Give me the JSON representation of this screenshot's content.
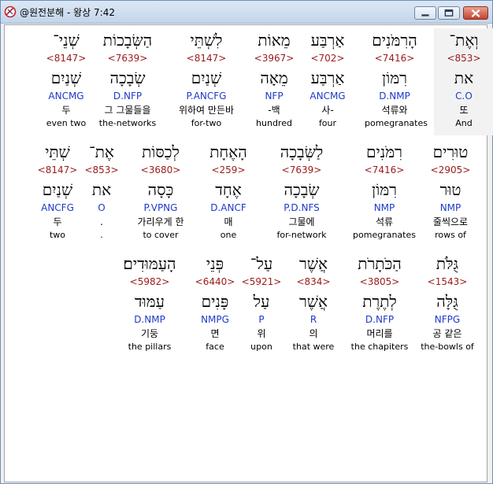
{
  "window": {
    "title": "@원전분해 - 왕상 7:42",
    "minimize_label": "minimize",
    "maximize_label": "maximize",
    "close_label": "close"
  },
  "rows": [
    {
      "words": [
        {
          "hebrew": "וְאֶת־",
          "strong": "<853>",
          "lexeme": "את",
          "morph": "C.O",
          "korean": "또",
          "english": "And",
          "highlight": true
        },
        {
          "hebrew": "הָרִמֹּנִים",
          "strong": "<7416>",
          "lexeme": "רִמּוֹן",
          "morph": "D.NMP",
          "korean": "석류와",
          "english": "pomegranates"
        },
        {
          "hebrew": "אַרְבַּע",
          "strong": "<702>",
          "lexeme": "אַרְבַּע",
          "morph": "ANCMG",
          "korean": "사-",
          "english": "four"
        },
        {
          "hebrew": "מֵאוֹת",
          "strong": "<3967>",
          "lexeme": "מֵאָה",
          "morph": "NFP",
          "korean": "-백",
          "english": "hundred"
        },
        {
          "hebrew": "לִשְׁתֵּי",
          "strong": "<8147>",
          "lexeme": "שְׁנַיִם",
          "morph": "P.ANCFG",
          "korean": "위하여 만든바",
          "english": "for-two"
        },
        {
          "hebrew": "הַשְּׂבָכוֹת",
          "strong": "<7639>",
          "lexeme": "שְׂבָכָה",
          "morph": "D.NFP",
          "korean": "그 그물들을",
          "english": "the-networks"
        },
        {
          "hebrew": "שְׁנֵי־",
          "strong": "<8147>",
          "lexeme": "שְׁנַיִם",
          "morph": "ANCMG",
          "korean": "두",
          "english": "even two"
        }
      ]
    },
    {
      "words": [
        {
          "hebrew": "טוּרִים",
          "strong": "<2905>",
          "lexeme": "טוּר",
          "morph": "NMP",
          "korean": "줄씩으로",
          "english": "rows of"
        },
        {
          "hebrew": "רִמֹּנִים",
          "strong": "<7416>",
          "lexeme": "רִמּוֹן",
          "morph": "NMP",
          "korean": "석류",
          "english": "pomegranates"
        },
        {
          "hebrew": "לַשְּׂבָכָה",
          "strong": "<7639>",
          "lexeme": "שְׂבָכָה",
          "morph": "P.D.NFS",
          "korean": "그물에",
          "english": "for-network"
        },
        {
          "hebrew": "הָאֶחָת",
          "strong": "<259>",
          "lexeme": "אֶחָד",
          "morph": "D.ANCF",
          "korean": "매",
          "english": "one"
        },
        {
          "hebrew": "לְכַסּוֹת",
          "strong": "<3680>",
          "lexeme": "כָּסָה",
          "morph": "P.VPNG",
          "korean": "가리우게 한",
          "english": "to cover"
        },
        {
          "hebrew": "אֶת־",
          "strong": "<853>",
          "lexeme": "את",
          "morph": "O",
          "korean": ".",
          "english": "."
        },
        {
          "hebrew": "שְׁתֵּי",
          "strong": "<8147>",
          "lexeme": "שְׁנַיִם",
          "morph": "ANCFG",
          "korean": "두",
          "english": "two"
        }
      ]
    },
    {
      "words": [
        {
          "hebrew": "גֻּלֹּת",
          "strong": "<1543>",
          "lexeme": "גֻּלָּה",
          "morph": "NFPG",
          "korean": "공 같은",
          "english": "the-bowls of"
        },
        {
          "hebrew": "הַכֹּתָרֹת",
          "strong": "<3805>",
          "lexeme": "לְתֶרֶת",
          "morph": "D.NFP",
          "korean": "머리를",
          "english": "the chapiters"
        },
        {
          "hebrew": "אֲשֶׁר",
          "strong": "<834>",
          "lexeme": "אֲשֶׁר",
          "morph": "R",
          "korean": "의",
          "english": "that were"
        },
        {
          "hebrew": "עַל־",
          "strong": "<5921>",
          "lexeme": "עַל",
          "morph": "P",
          "korean": "위",
          "english": "upon"
        },
        {
          "hebrew": "פְּנֵי",
          "strong": "<6440>",
          "lexeme": "פָּנִים",
          "morph": "NMPG",
          "korean": "면",
          "english": "face"
        },
        {
          "hebrew": "הָעַמּוּדִים׃",
          "strong": "<5982>",
          "lexeme": "עַמּוּד",
          "morph": "D.NMP",
          "korean": "기둥",
          "english": "the pillars"
        }
      ]
    }
  ]
}
